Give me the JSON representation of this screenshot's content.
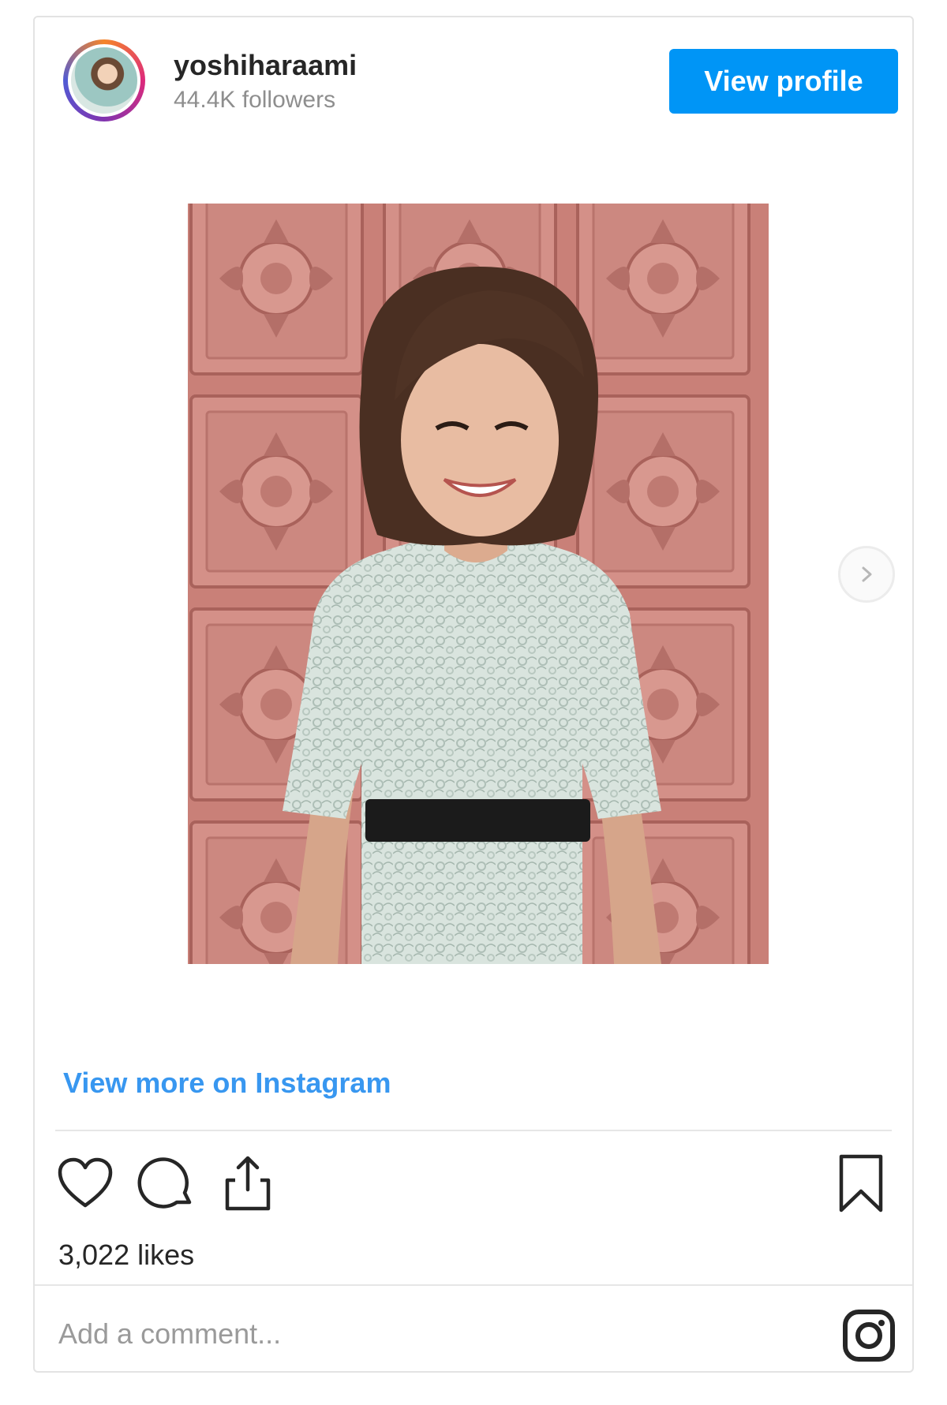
{
  "profile": {
    "username": "yoshiharaami",
    "followers": "44.4K followers",
    "view_profile_label": "View profile"
  },
  "post": {
    "image_alt": "photo",
    "view_more_label": "View more on Instagram",
    "likes": "3,022 likes",
    "comment_placeholder": "Add a comment..."
  },
  "icons": {
    "like": "heart-icon",
    "comment": "comment-icon",
    "share": "share-icon",
    "save": "bookmark-icon",
    "next": "chevron-right-icon",
    "brand": "instagram-icon"
  },
  "colors": {
    "accent": "#0095f6",
    "link": "#3897f0",
    "text": "#262626",
    "muted": "#8e8e8e"
  }
}
